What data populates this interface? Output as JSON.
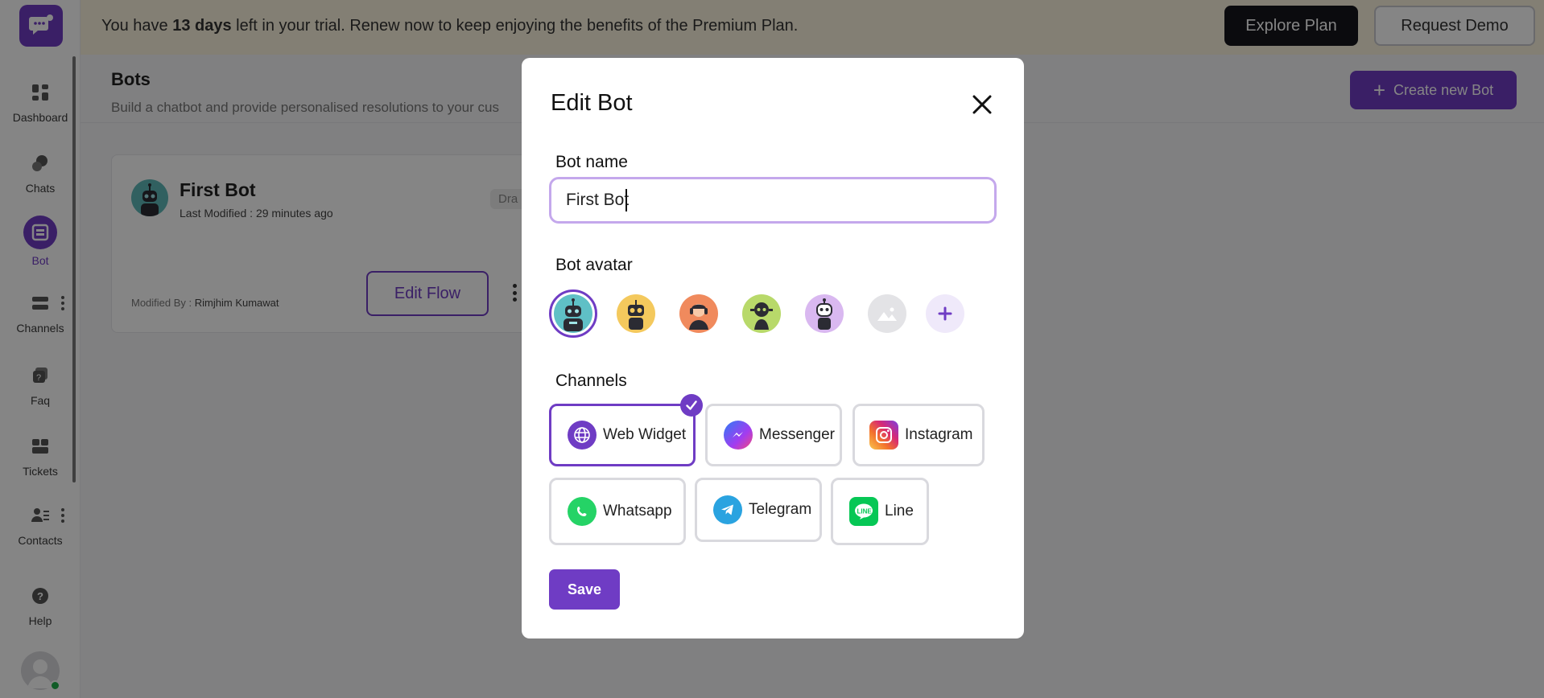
{
  "sidebar": {
    "logo": "chat-logo-icon",
    "items": [
      {
        "label": "Dashboard",
        "icon": "dashboard-icon"
      },
      {
        "label": "Chats",
        "icon": "chats-icon"
      },
      {
        "label": "Bot",
        "icon": "bot-icon",
        "active": true
      },
      {
        "label": "Channels",
        "icon": "channels-icon"
      },
      {
        "label": "Faq",
        "icon": "faq-icon"
      },
      {
        "label": "Tickets",
        "icon": "tickets-icon"
      },
      {
        "label": "Contacts",
        "icon": "contacts-icon"
      },
      {
        "label": "Help",
        "icon": "help-icon"
      }
    ]
  },
  "banner": {
    "text_before": "You have ",
    "days": "13 days",
    "text_after": " left in your trial. Renew now to keep enjoying the benefits of the Premium Plan.",
    "explore_label": "Explore Plan",
    "demo_label": "Request Demo"
  },
  "page": {
    "title": "Bots",
    "subtitle": "Build a chatbot and provide personalised resolutions to your cus",
    "create_label": "Create new Bot"
  },
  "bot_card": {
    "name": "First Bot",
    "last_modified": "Last Modified : 29 minutes ago",
    "status": "Dra",
    "modified_by_label": "Modified By : ",
    "modified_by_name": "Rimjhim Kumawat",
    "edit_flow_label": "Edit Flow"
  },
  "modal": {
    "title": "Edit Bot",
    "bot_name_label": "Bot name",
    "bot_name_value": "First Bot",
    "bot_avatar_label": "Bot avatar",
    "avatars": [
      {
        "name": "teal-robot-avatar",
        "color": "#5fc0c6",
        "selected": true
      },
      {
        "name": "yellow-robot-avatar",
        "color": "#f4c95d"
      },
      {
        "name": "orange-person-avatar",
        "color": "#f08a5d"
      },
      {
        "name": "green-robot-avatar",
        "color": "#b8d96a"
      },
      {
        "name": "purple-robot-avatar",
        "color": "#d9b8f0"
      },
      {
        "name": "image-placeholder-avatar",
        "color": "#e3e3e6"
      }
    ],
    "channels_label": "Channels",
    "channels": [
      {
        "label": "Web Widget",
        "icon": "globe-icon",
        "selected": true
      },
      {
        "label": "Messenger",
        "icon": "messenger-icon"
      },
      {
        "label": "Instagram",
        "icon": "instagram-icon"
      },
      {
        "label": "Whatsapp",
        "icon": "whatsapp-icon"
      },
      {
        "label": "Telegram",
        "icon": "telegram-icon"
      },
      {
        "label": "Line",
        "icon": "line-icon"
      }
    ],
    "save_label": "Save"
  },
  "colors": {
    "brand": "#6f3cc4",
    "banner_bg": "#fbf4de",
    "input_border": "#c4a8ec"
  }
}
